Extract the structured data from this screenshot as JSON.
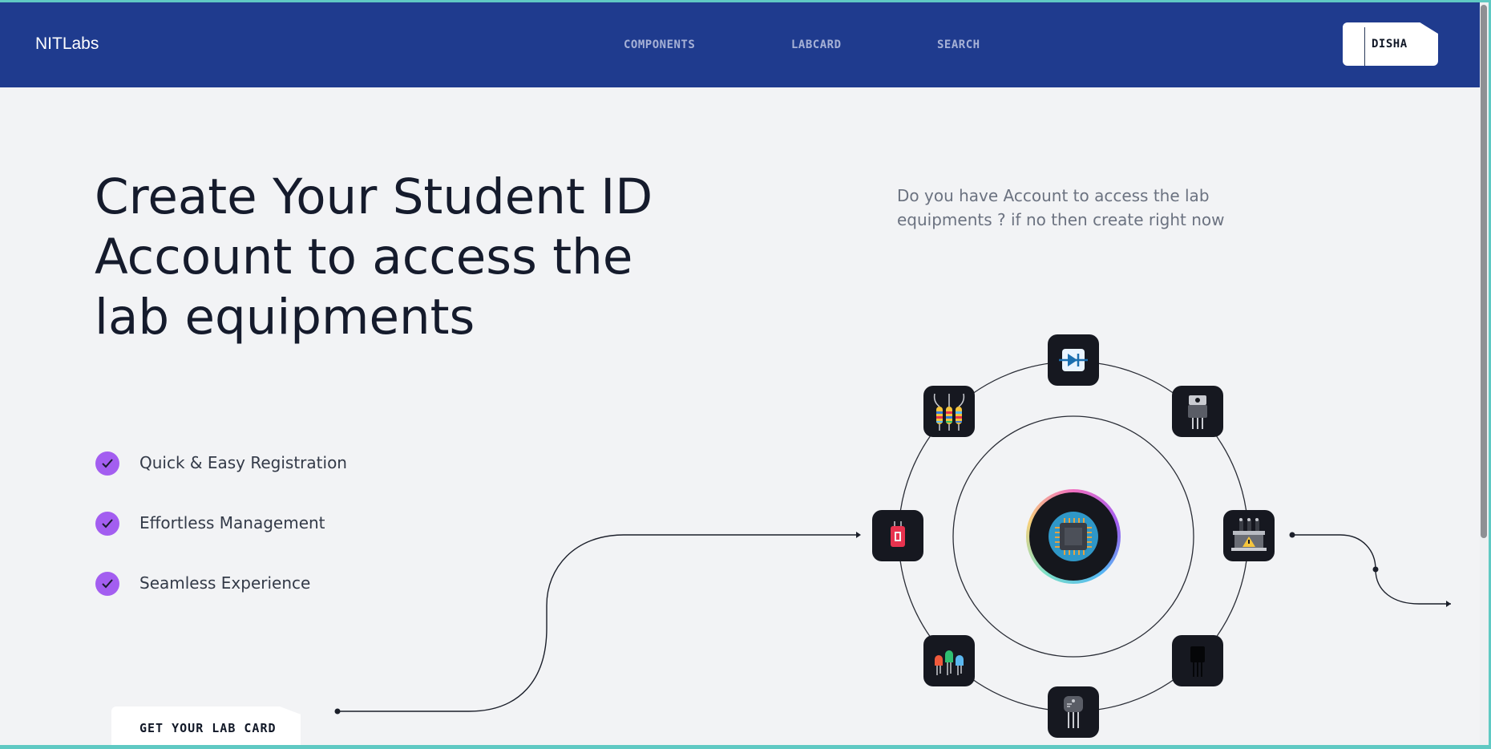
{
  "navbar": {
    "brand": "NITLabs",
    "links": [
      "COMPONENTS",
      "LABCARD",
      "SEARCH"
    ],
    "user": "DISHA"
  },
  "hero": {
    "title": "Create Your Student ID Account to access the lab equipments",
    "subtitle": "Do you have Account to access the lab equipments ? if no then create right now",
    "features": [
      "Quick & Easy Registration",
      "Effortless Management",
      "Seamless Experience"
    ],
    "cta": "GET YOUR LAB CARD"
  },
  "orbit": {
    "center": "microchip-icon",
    "components": [
      "diode-icon",
      "voltage-regulator-icon",
      "transformer-icon",
      "mosfet-icon",
      "transistor-icon",
      "led-icon",
      "capacitor-icon",
      "resistors-icon"
    ]
  },
  "colors": {
    "navbar": "#1f3b8e",
    "background": "#f2f3f5",
    "accent": "#a35ef0",
    "node": "#161820",
    "text": "#151b2c"
  }
}
